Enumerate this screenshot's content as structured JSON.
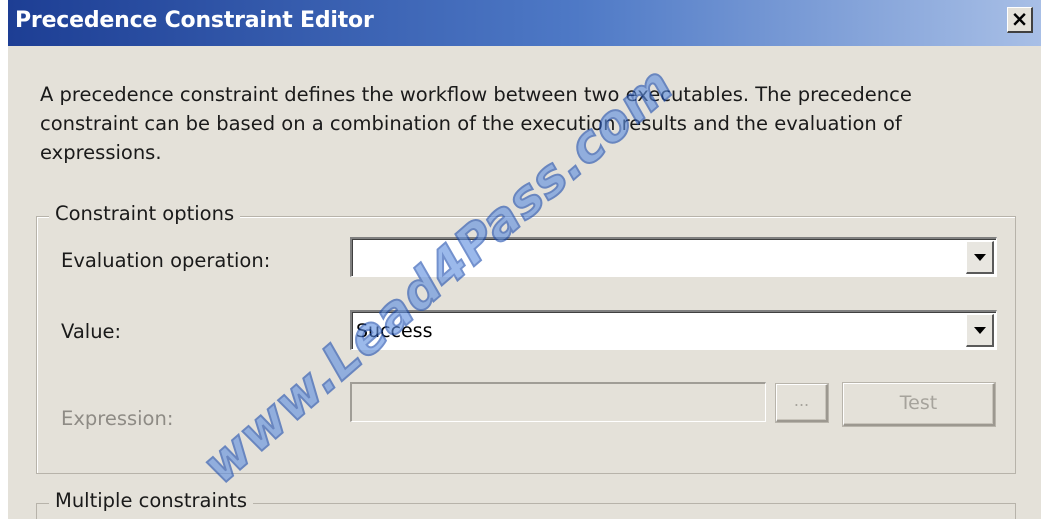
{
  "window": {
    "title": "Precedence Constraint Editor",
    "close_label": "×"
  },
  "description": "A precedence constraint defines the workflow between two executables. The precedence constraint can be based on a combination of the execution results and the evaluation of expressions.",
  "constraint_options": {
    "legend": "Constraint options",
    "evaluation_operation": {
      "label": "Evaluation operation:",
      "value": ""
    },
    "value": {
      "label": "Value:",
      "value": "Success"
    },
    "expression": {
      "label": "Expression:",
      "value": "",
      "browse_label": "...",
      "test_label": "Test",
      "enabled": false
    }
  },
  "multiple_constraints": {
    "legend": "Multiple constraints"
  },
  "watermark": "www.Lead4Pass.com",
  "colors": {
    "titlebar_start": "#1d3e94",
    "titlebar_end": "#a8bfe6",
    "dialog_bg": "#e4e1d9",
    "watermark": "#5f8fe0"
  }
}
